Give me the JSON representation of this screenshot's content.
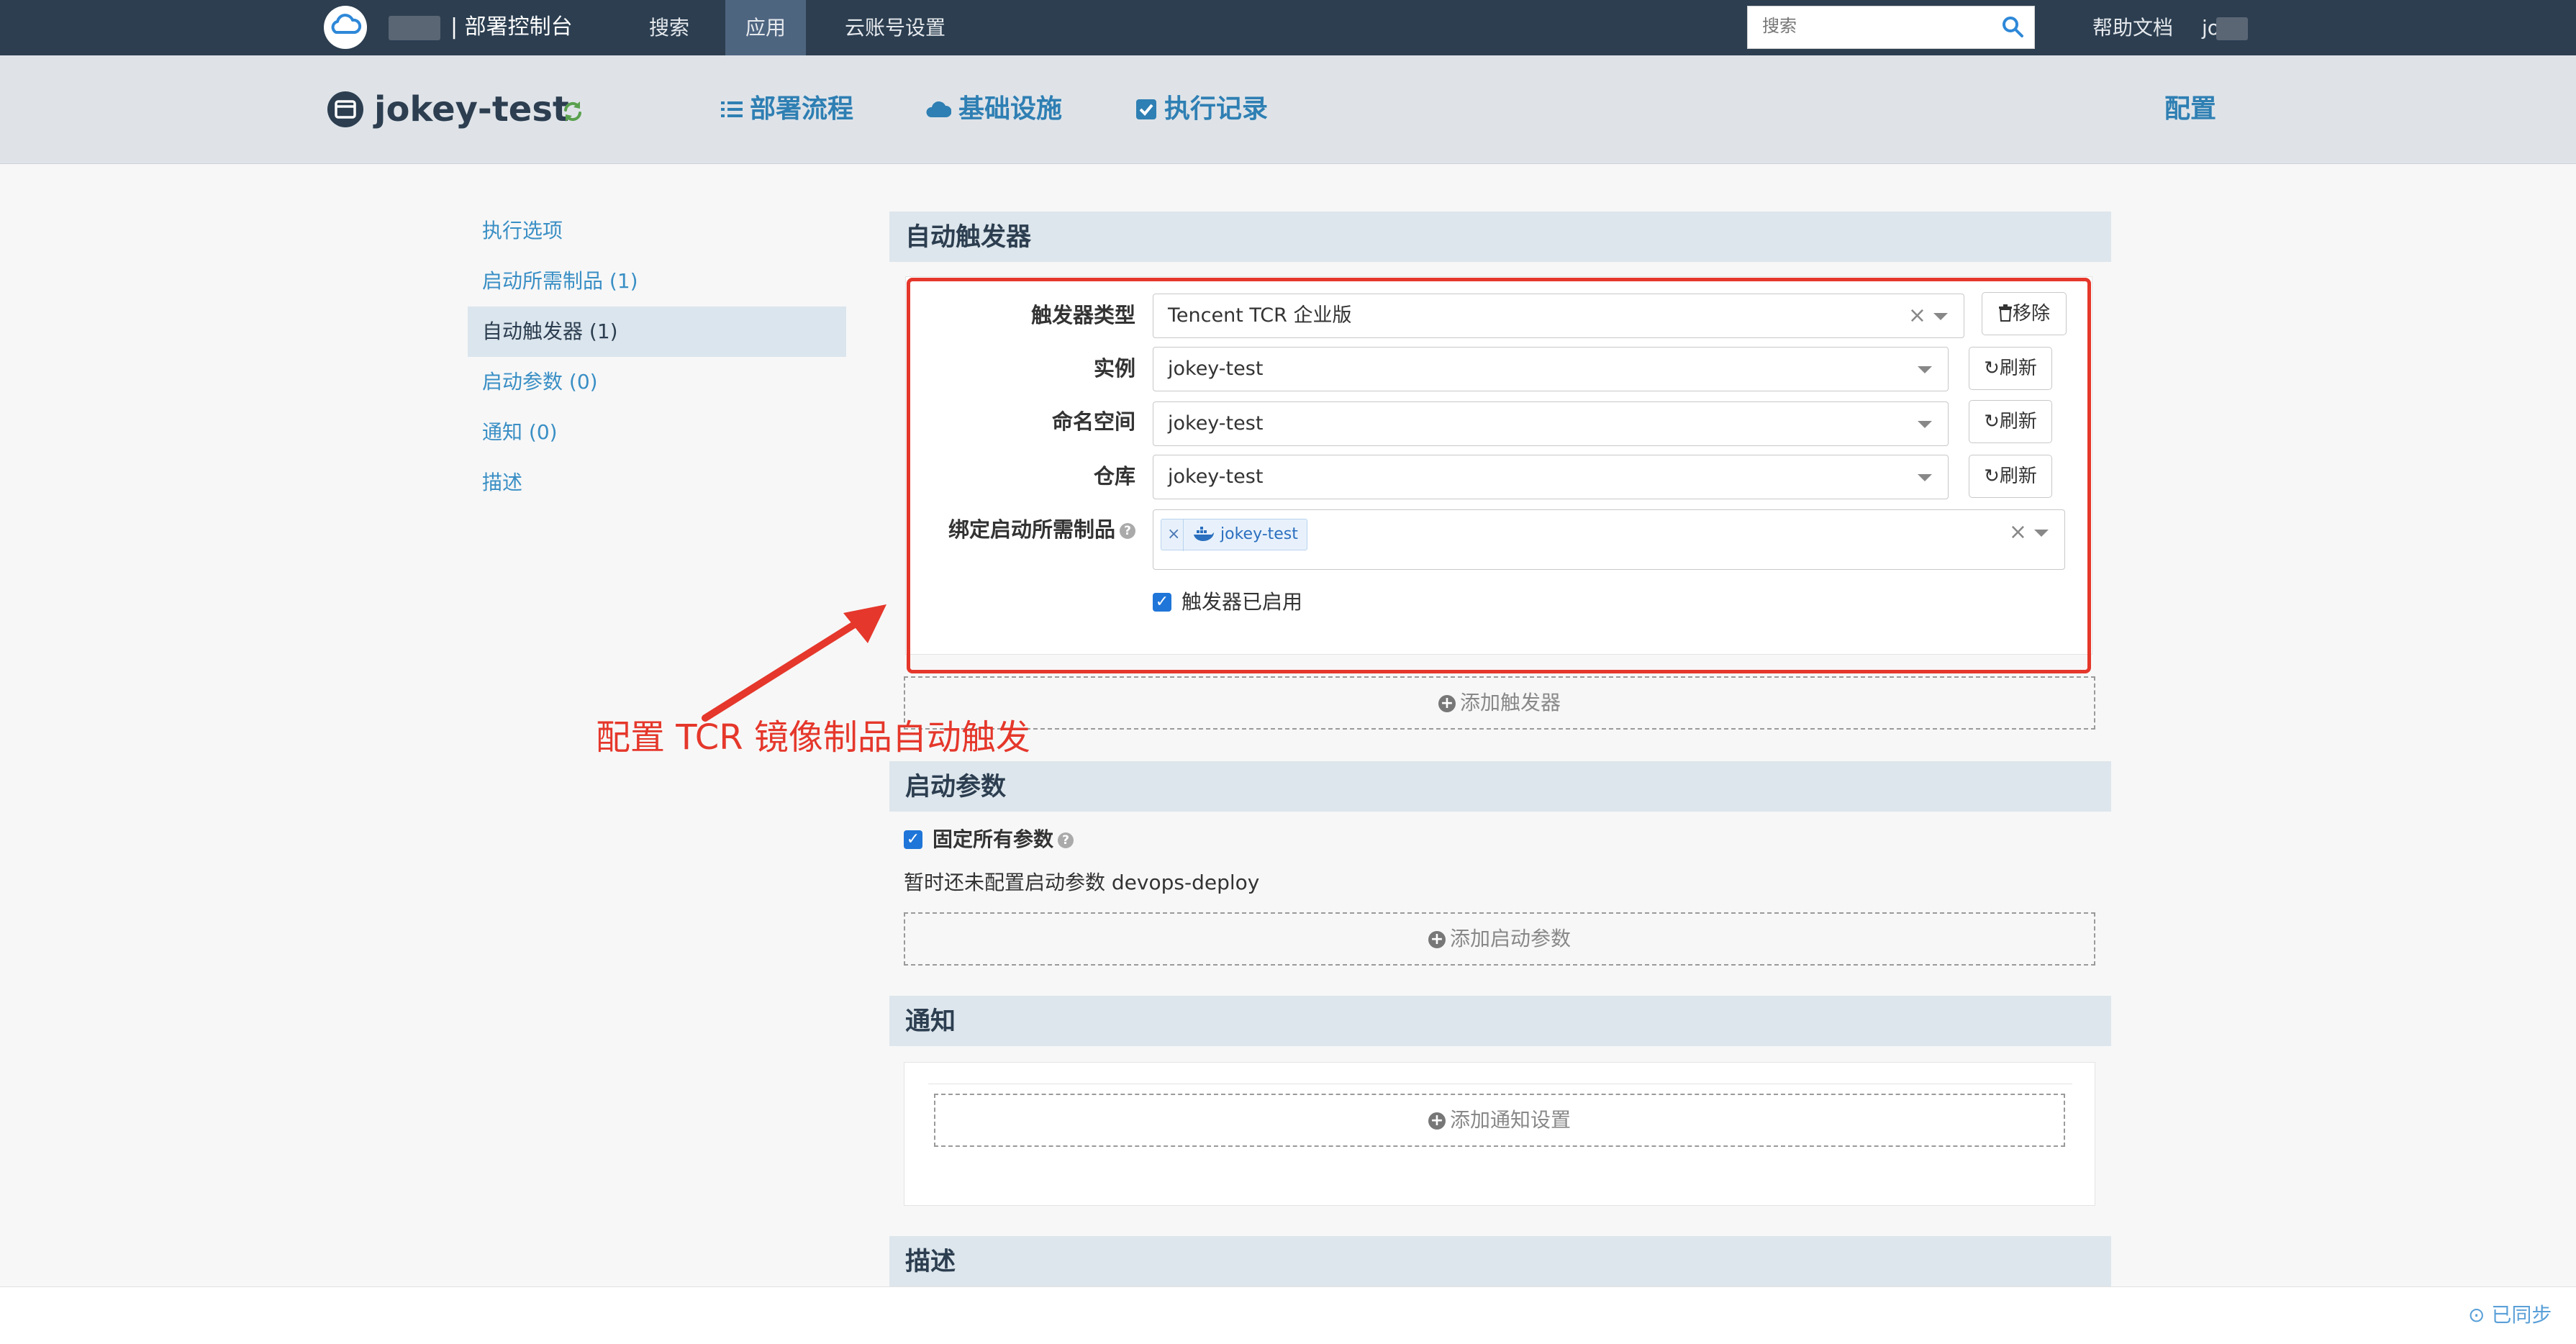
{
  "topbar": {
    "brand": "部署控制台",
    "nav": [
      {
        "label": "搜索"
      },
      {
        "label": "应用"
      },
      {
        "label": "云账号设置"
      }
    ],
    "search_placeholder": "搜索",
    "help": "帮助文档",
    "user": "jo"
  },
  "app": {
    "title": "jokey-test",
    "tabs": [
      {
        "label": "部署流程"
      },
      {
        "label": "基础设施"
      },
      {
        "label": "执行记录"
      }
    ],
    "config": "配置"
  },
  "sidebar": {
    "items": [
      {
        "label": "执行选项"
      },
      {
        "label": "启动所需制品 (1)"
      },
      {
        "label": "自动触发器 (1)"
      },
      {
        "label": "启动参数 (0)"
      },
      {
        "label": "通知 (0)"
      },
      {
        "label": "描述"
      }
    ]
  },
  "triggers": {
    "heading": "自动触发器",
    "type_label": "触发器类型",
    "type_value": "Tencent TCR 企业版",
    "remove_label": "移除",
    "instance_label": "实例",
    "instance_value": "jokey-test",
    "namespace_label": "命名空间",
    "namespace_value": "jokey-test",
    "repo_label": "仓库",
    "repo_value": "jokey-test",
    "refresh_label": "刷新",
    "bind_label": "绑定启动所需制品",
    "bind_tag": "jokey-test",
    "enabled_label": "触发器已启用",
    "add_label": "添加触发器"
  },
  "annotation": "配置 TCR 镜像制品自动触发",
  "params": {
    "heading": "启动参数",
    "fixed_label": "固定所有参数",
    "empty_text": "暂时还未配置启动参数 devops-deploy",
    "add_label": "添加启动参数"
  },
  "notify": {
    "heading": "通知",
    "add_label": "添加通知设置"
  },
  "desc": {
    "heading": "描述"
  },
  "status": {
    "sync": "已同步"
  },
  "colors": {
    "topbar": "#2c3e50",
    "accent": "#2e7fb3",
    "annotation": "#e5372b"
  }
}
